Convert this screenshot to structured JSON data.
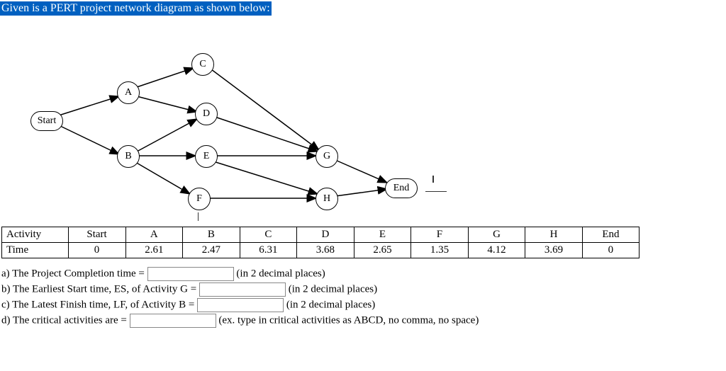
{
  "title": "Given is a PERT project network diagram as shown below:",
  "nodes": {
    "Start": "Start",
    "A": "A",
    "B": "B",
    "C": "C",
    "D": "D",
    "E": "E",
    "F": "F",
    "G": "G",
    "H": "H",
    "End": "End"
  },
  "table": {
    "rows": [
      "Activity",
      "Time"
    ],
    "headers": [
      "Start",
      "A",
      "B",
      "C",
      "D",
      "E",
      "F",
      "G",
      "H",
      "End"
    ],
    "values": [
      "0",
      "2.61",
      "2.47",
      "6.31",
      "3.68",
      "2.65",
      "1.35",
      "4.12",
      "3.69",
      "0"
    ]
  },
  "questions": {
    "a_pre": "a) The Project Completion time = ",
    "a_post": " (in 2 decimal places)",
    "b_pre": "b) The Earliest Start time, ES, of Activity G = ",
    "b_post": " (in 2 decimal places)",
    "c_pre": "c) The Latest Finish time, LF, of Activity B = ",
    "c_post": " (in 2 decimal places)",
    "d_pre": "d) The critical activities are = ",
    "d_post": " (ex. type in critical activities as ABCD, no comma, no space)"
  },
  "chart_data": {
    "type": "network",
    "nodes": [
      "Start",
      "A",
      "B",
      "C",
      "D",
      "E",
      "F",
      "G",
      "H",
      "End"
    ],
    "edges": [
      [
        "Start",
        "A"
      ],
      [
        "Start",
        "B"
      ],
      [
        "A",
        "C"
      ],
      [
        "A",
        "D"
      ],
      [
        "B",
        "D"
      ],
      [
        "B",
        "E"
      ],
      [
        "B",
        "F"
      ],
      [
        "C",
        "G"
      ],
      [
        "D",
        "G"
      ],
      [
        "E",
        "G"
      ],
      [
        "F",
        "H"
      ],
      [
        "E",
        "H"
      ],
      [
        "G",
        "End"
      ],
      [
        "H",
        "End"
      ]
    ],
    "durations": {
      "Start": 0,
      "A": 2.61,
      "B": 2.47,
      "C": 6.31,
      "D": 3.68,
      "E": 2.65,
      "F": 1.35,
      "G": 4.12,
      "H": 3.69,
      "End": 0
    }
  }
}
